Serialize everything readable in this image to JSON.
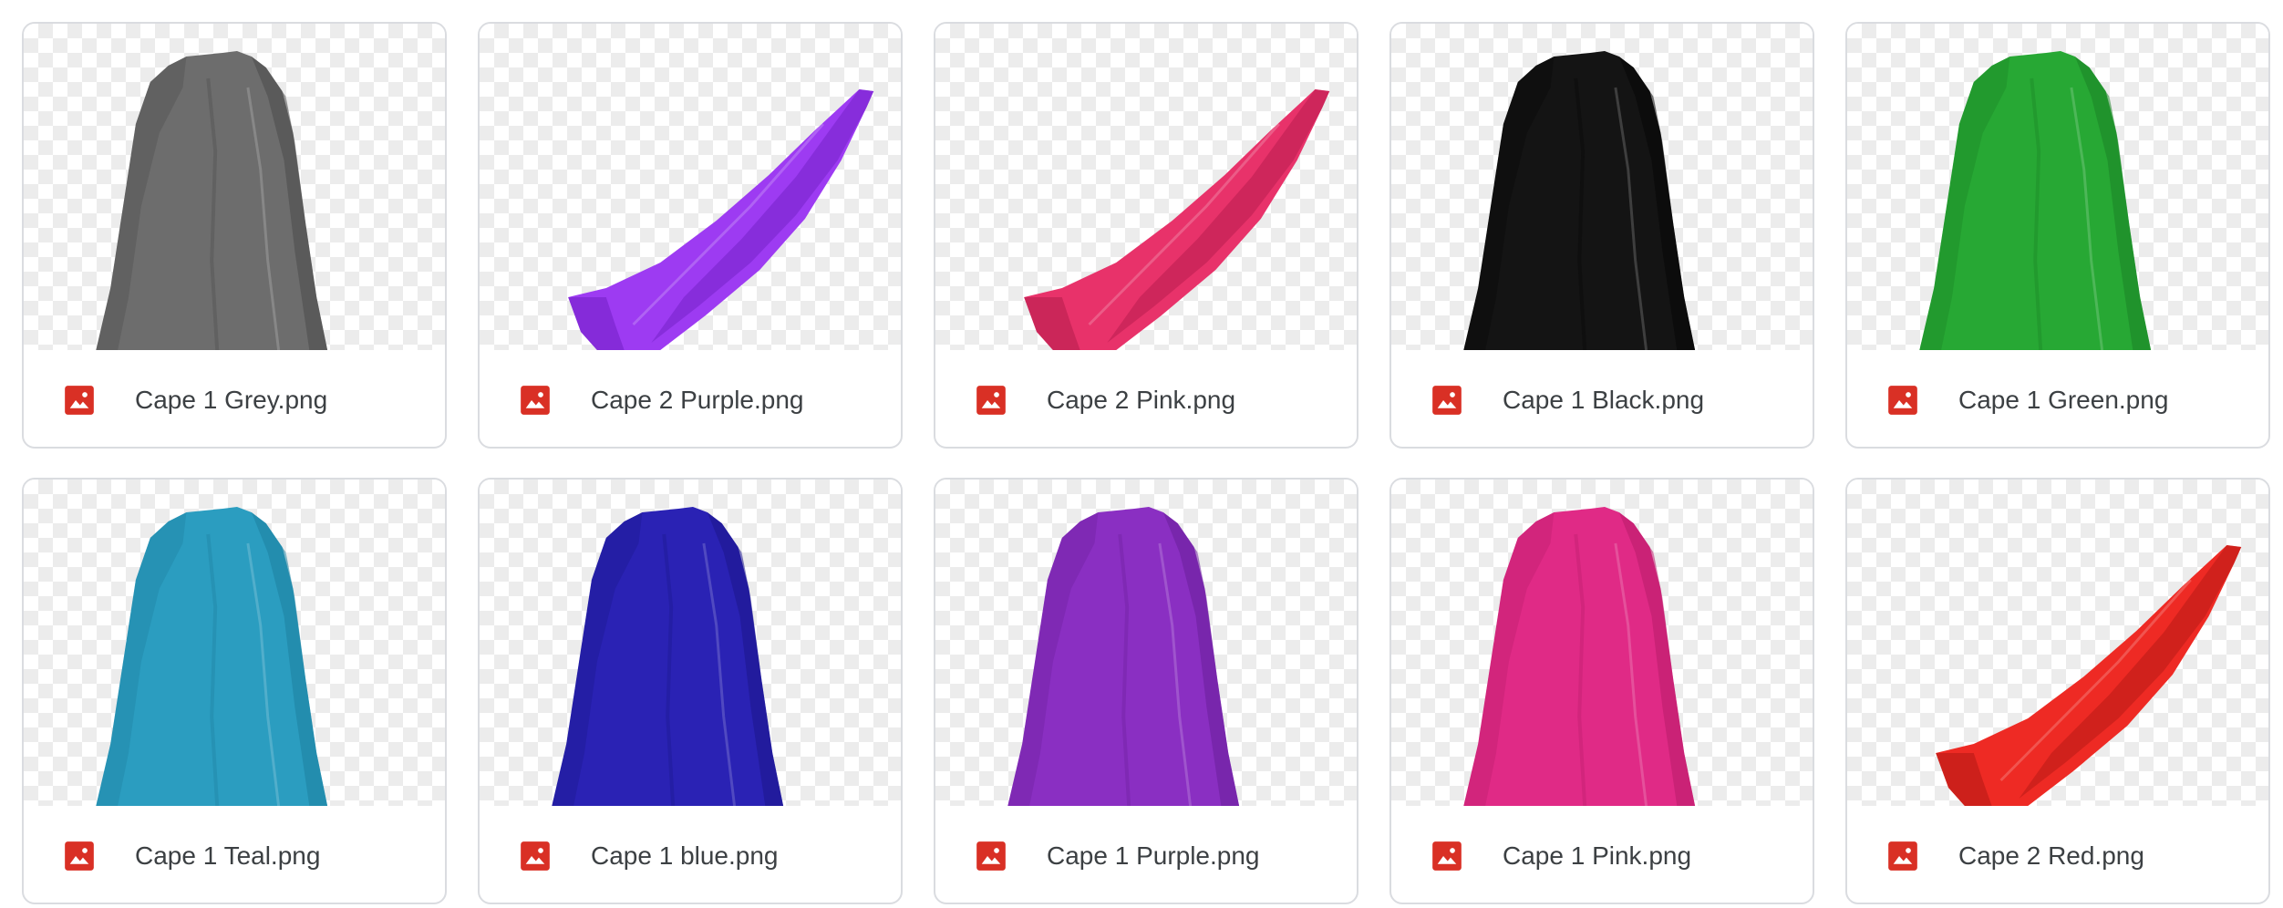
{
  "files": [
    {
      "name": "Cape 1 Grey.png",
      "color": "#6d6d6d",
      "shade": "#4a4a4a",
      "shape": "cape1",
      "icon": "image-file-icon"
    },
    {
      "name": "Cape 2 Purple.png",
      "color": "#9d3bf2",
      "shade": "#7422c8",
      "shape": "cape2",
      "icon": "image-file-icon"
    },
    {
      "name": "Cape 2 Pink.png",
      "color": "#e8326a",
      "shade": "#b81e4e",
      "shape": "cape2",
      "icon": "image-file-icon"
    },
    {
      "name": "Cape 1 Black.png",
      "color": "#141414",
      "shade": "#050505",
      "shape": "cape1",
      "icon": "image-file-icon"
    },
    {
      "name": "Cape 1 Green.png",
      "color": "#27a834",
      "shade": "#1b8226",
      "shape": "cape1",
      "icon": "image-file-icon"
    },
    {
      "name": "Cape 1 Teal.png",
      "color": "#2b9dc0",
      "shade": "#1d7f9e",
      "shape": "cape1",
      "icon": "image-file-icon"
    },
    {
      "name": "Cape 1 blue.png",
      "color": "#2a22b4",
      "shade": "#1b168a",
      "shape": "cape1",
      "icon": "image-file-icon"
    },
    {
      "name": "Cape 1 Purple.png",
      "color": "#8a2fc2",
      "shade": "#6a1f9a",
      "shape": "cape1",
      "icon": "image-file-icon"
    },
    {
      "name": "Cape 1 Pink.png",
      "color": "#e02a86",
      "shade": "#b81c6a",
      "shape": "cape1",
      "icon": "image-file-icon"
    },
    {
      "name": "Cape 2 Red.png",
      "color": "#ee2a24",
      "shade": "#b81a16",
      "shape": "cape2",
      "icon": "image-file-icon"
    }
  ],
  "icon_color": "#d93025"
}
